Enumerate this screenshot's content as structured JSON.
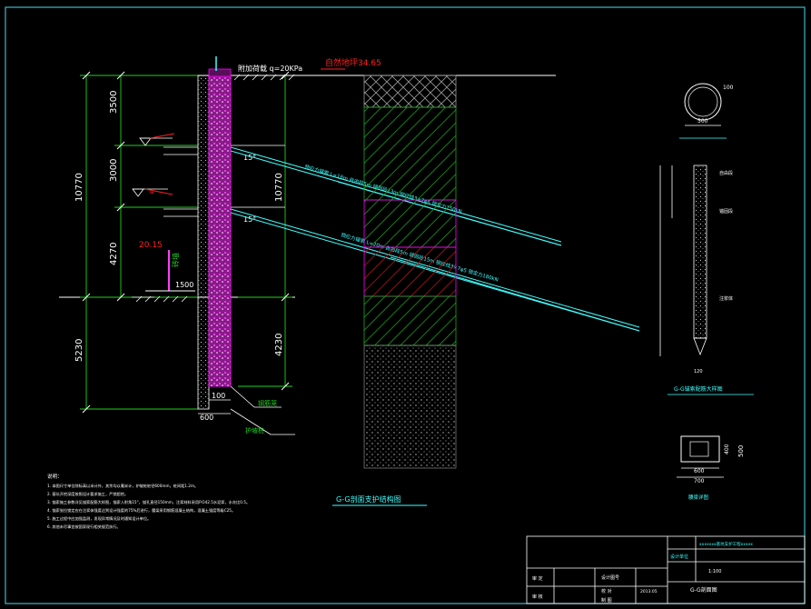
{
  "drawing": {
    "top_load_label": "附加荷载 q=20KPa",
    "top_elev_label": "自然地坪34.65",
    "dims_left": [
      "3500",
      "3000",
      "4270",
      "5230"
    ],
    "dims_total": "10770",
    "dims_right": [
      "10770",
      "4230"
    ],
    "angle_labels": [
      "15°",
      "15°"
    ],
    "left_small_labels": [
      "20.15",
      "1500"
    ],
    "bottom_dims": [
      "100",
      "600"
    ],
    "pile_labels": [
      "钢筋笼",
      "护坡桩"
    ],
    "left_wall_label": "砖墙",
    "section_title": "G-G剖面支护结构图",
    "anchor_labels": [
      "预应力锚索 L=18m 自由段5m 锚固段13m 钢绞线3×7φ5 锁定力150kN",
      "预应力锚索 L=20m 自由段5m 锚固段15m 钢绞线3×7φ5 锁定力180kN"
    ],
    "anchor_detail": {
      "circle_dims": [
        "500",
        "100"
      ],
      "title": "G-G锚索配筋大样图",
      "side_labels": [
        "自由段",
        "锚固段",
        "注浆体"
      ],
      "bottom_dim": "120"
    },
    "waler": {
      "dims": [
        "600",
        "700",
        "400",
        "500"
      ],
      "title": "腰梁详图"
    },
    "notes_title": "说明：",
    "notes": [
      "1. 本图尺寸单位除标高以米计外，其余均以毫米计，护坡桩桩径600mm，桩间距1.2m。",
      "2. 基坑开挖深度按照设计要求施工，严禁超挖。",
      "3. 锚索施工参数详见锚索配筋大样图，锚索入射角15°，锚孔直径150mm，注浆材料采用P.O42.5水泥浆，水灰比0.5。",
      "4. 锚索张拉锁定应在注浆体强度达到设计强度的75%后进行，腰梁采用钢筋混凝土结构，混凝土强度等级C25。",
      "5. 施工过程中应加强监测，发现异常情况及时通知设计单位。",
      "6. 其他未尽事宜按国家现行相关规范执行。"
    ],
    "title_block": {
      "project_name": "xxxxxxx基坑支护工程xxxxx",
      "unit_label": "设计单位",
      "rows": [
        "审 定",
        "审 核"
      ],
      "design_label": "设计图号",
      "checker_label": "校 对",
      "drawer_label": "制 图",
      "sheet_title": "G-G剖面图",
      "date_text": "2013.05",
      "scale": "1:100"
    }
  },
  "colors": {
    "border": "#3fb8c8",
    "green": "#00ff00",
    "red": "#ff2020",
    "magenta": "#ff00ff",
    "cyan": "#40ffff",
    "white": "#ffffff",
    "dim": "#1fd11f"
  }
}
